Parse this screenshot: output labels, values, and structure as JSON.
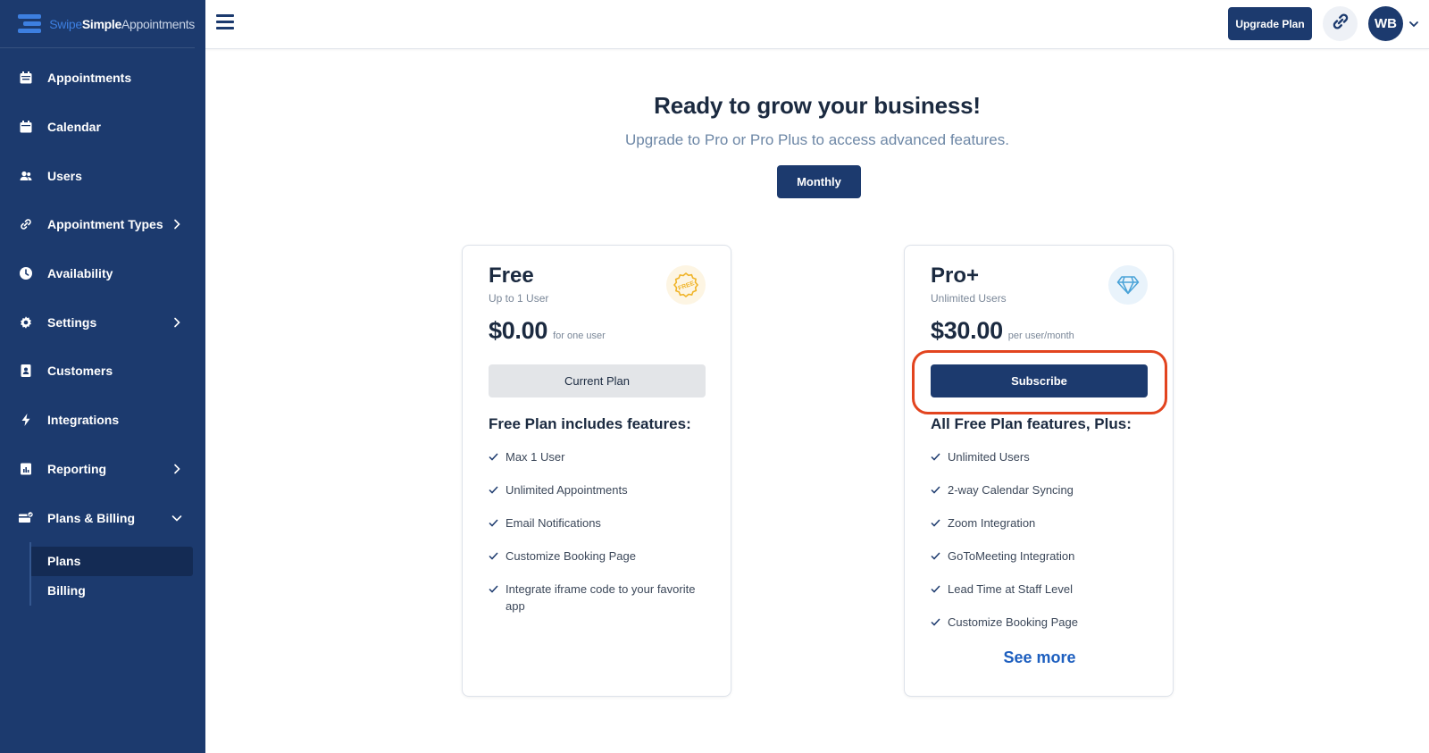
{
  "brand": {
    "swipe": "Swipe",
    "simple": "Simple",
    "appointments": "Appointments"
  },
  "sidebar": {
    "items": [
      {
        "label": "Appointments",
        "icon": "calendar-check-icon"
      },
      {
        "label": "Calendar",
        "icon": "calendar-icon"
      },
      {
        "label": "Users",
        "icon": "users-icon"
      },
      {
        "label": "Appointment Types",
        "icon": "link-icon",
        "expandable": true
      },
      {
        "label": "Availability",
        "icon": "clock-icon"
      },
      {
        "label": "Settings",
        "icon": "gear-icon",
        "expandable": true
      },
      {
        "label": "Customers",
        "icon": "contact-card-icon"
      },
      {
        "label": "Integrations",
        "icon": "bolt-icon"
      },
      {
        "label": "Reporting",
        "icon": "report-icon",
        "expandable": true
      },
      {
        "label": "Plans & Billing",
        "icon": "billing-icon",
        "expanded": true
      }
    ],
    "subitems": [
      {
        "label": "Plans",
        "active": true
      },
      {
        "label": "Billing",
        "active": false
      }
    ]
  },
  "topbar": {
    "upgrade_label": "Upgrade Plan",
    "avatar_initials": "WB"
  },
  "main": {
    "headline": "Ready to grow your business!",
    "subhead": "Upgrade to Pro or Pro Plus to access advanced features.",
    "period_label": "Monthly"
  },
  "plans": {
    "free": {
      "name": "Free",
      "users": "Up to 1 User",
      "price": "$0.00",
      "price_note": "for one user",
      "button": "Current Plan",
      "features_title": "Free Plan includes features:",
      "features": [
        "Max 1 User",
        "Unlimited Appointments",
        "Email Notifications",
        "Customize Booking Page",
        "Integrate iframe code to your favorite app"
      ],
      "badge_text": "FREE"
    },
    "pro": {
      "name": "Pro+",
      "users": "Unlimited Users",
      "price": "$30.00",
      "price_note": "per user/month",
      "button": "Subscribe",
      "features_title": "All Free Plan features, Plus:",
      "features": [
        "Unlimited Users",
        "2-way Calendar Syncing",
        "Zoom Integration",
        "GoToMeeting Integration",
        "Lead Time at Staff Level",
        "Customize Booking Page"
      ],
      "see_more": "See more"
    }
  },
  "colors": {
    "sidebar_bg": "#1c3a6e",
    "primary": "#1c3a6e",
    "highlight_ring": "#e2441f",
    "link": "#1d5fbf"
  }
}
